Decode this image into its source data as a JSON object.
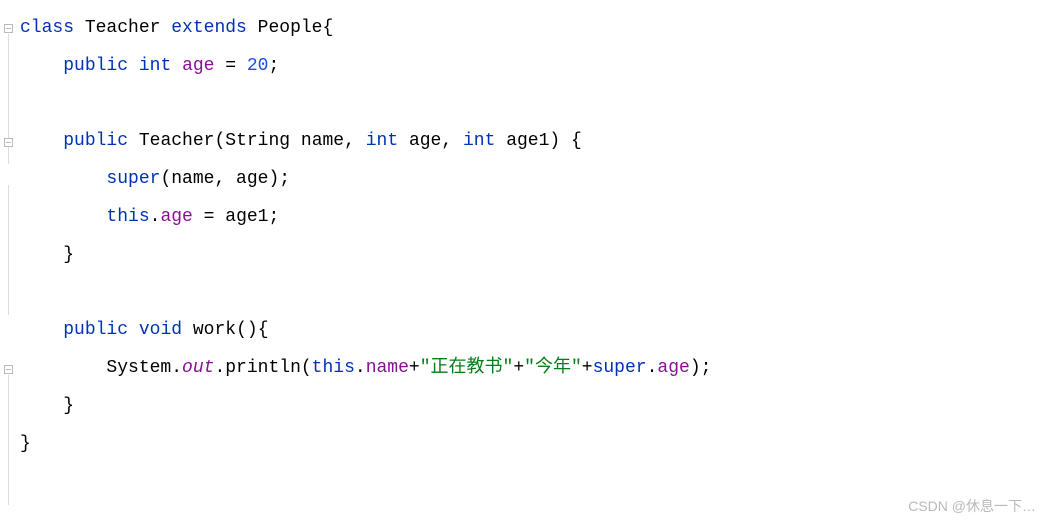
{
  "code": {
    "line1": {
      "kw_class": "class",
      "class_name": " Teacher ",
      "kw_extends": "extends",
      "parent": " People",
      "brace": "{"
    },
    "line2": {
      "indent": "    ",
      "kw_public": "public",
      "sp1": " ",
      "kw_int": "int",
      "sp2": " ",
      "field": "age",
      "sp3": " = ",
      "value": "20",
      "semi": ";"
    },
    "line3": {
      "blank": ""
    },
    "line4": {
      "indent": "    ",
      "kw_public": "public",
      "sp1": " ",
      "ctor": "Teacher",
      "open": "(",
      "type1": "String ",
      "p1": "name",
      "comma1": ", ",
      "kw_int1": "int",
      "sp2": " ",
      "p2": "age",
      "comma2": ", ",
      "kw_int2": "int",
      "sp3": " ",
      "p3": "age1",
      "close": ") {"
    },
    "line5": {
      "indent": "        ",
      "kw_super": "super",
      "rest": "(name, age);"
    },
    "line6": {
      "indent": "        ",
      "kw_this": "this",
      "dot": ".",
      "field": "age",
      "rest": " = age1;"
    },
    "line7": {
      "indent": "    ",
      "brace": "}"
    },
    "line8": {
      "blank": ""
    },
    "line9": {
      "indent": "    ",
      "kw_public": "public",
      "sp1": " ",
      "kw_void": "void",
      "sp2": " ",
      "method": "work",
      "rest": "(){"
    },
    "line10": {
      "indent": "        ",
      "sys": "System.",
      "out": "out",
      "println": ".println(",
      "kw_this": "this",
      "dot": ".",
      "name_field": "name",
      "plus1": "+",
      "str1": "\"正在教书\"",
      "plus2": "+",
      "str2": "\"今年\"",
      "plus3": "+",
      "kw_super": "super",
      "dot2": ".",
      "age_field": "age",
      "end": ");"
    },
    "line11": {
      "indent": "    ",
      "brace": "}"
    },
    "line12": {
      "brace": "}"
    }
  },
  "watermark": "CSDN @休息一下…"
}
